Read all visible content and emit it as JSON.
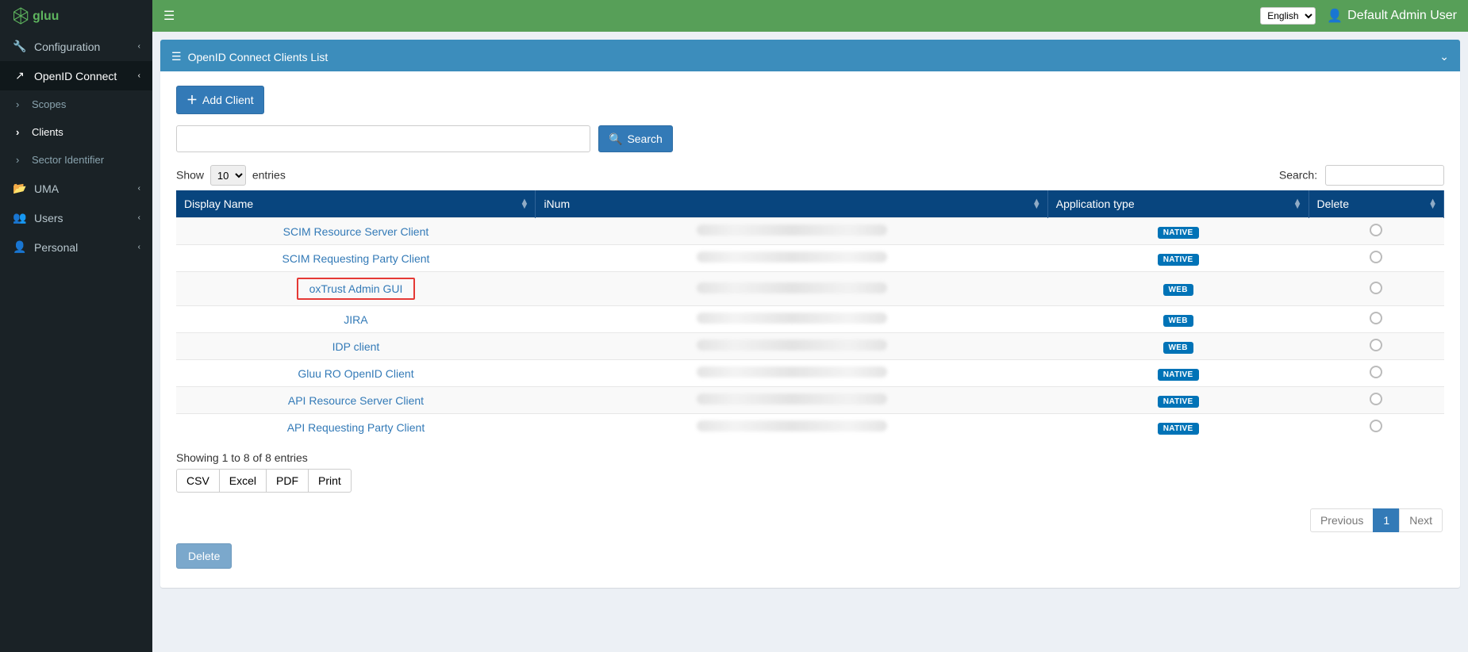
{
  "header": {
    "language_selected": "English",
    "user_label": "Default Admin User"
  },
  "sidebar": {
    "items": [
      {
        "label": "Configuration",
        "icon": "wrench-icon"
      },
      {
        "label": "OpenID Connect",
        "icon": "external-link-icon"
      },
      {
        "label": "UMA",
        "icon": "folder-open-icon"
      },
      {
        "label": "Users",
        "icon": "users-icon"
      },
      {
        "label": "Personal",
        "icon": "user-icon"
      }
    ],
    "openid_sub": [
      {
        "label": "Scopes"
      },
      {
        "label": "Clients"
      },
      {
        "label": "Sector Identifier"
      }
    ]
  },
  "panel": {
    "title": "OpenID Connect Clients List",
    "add_client_label": "Add Client",
    "search_button_label": "Search",
    "length_prefix": "Show",
    "length_suffix": "entries",
    "length_value": "10",
    "filter_label": "Search:",
    "columns": {
      "display_name": "Display Name",
      "inum": "iNum",
      "app_type": "Application type",
      "delete": "Delete"
    },
    "rows": [
      {
        "name": "SCIM Resource Server Client",
        "type": "NATIVE",
        "highlight": false
      },
      {
        "name": "SCIM Requesting Party Client",
        "type": "NATIVE",
        "highlight": false
      },
      {
        "name": "oxTrust Admin GUI",
        "type": "WEB",
        "highlight": true
      },
      {
        "name": "JIRA",
        "type": "WEB",
        "highlight": false
      },
      {
        "name": "IDP client",
        "type": "WEB",
        "highlight": false
      },
      {
        "name": "Gluu RO OpenID Client",
        "type": "NATIVE",
        "highlight": false
      },
      {
        "name": "API Resource Server Client",
        "type": "NATIVE",
        "highlight": false
      },
      {
        "name": "API Requesting Party Client",
        "type": "NATIVE",
        "highlight": false
      }
    ],
    "info_text": "Showing 1 to 8 of 8 entries",
    "export": [
      "CSV",
      "Excel",
      "PDF",
      "Print"
    ],
    "pagination": {
      "previous": "Previous",
      "next": "Next",
      "current": "1"
    },
    "delete_label": "Delete"
  }
}
